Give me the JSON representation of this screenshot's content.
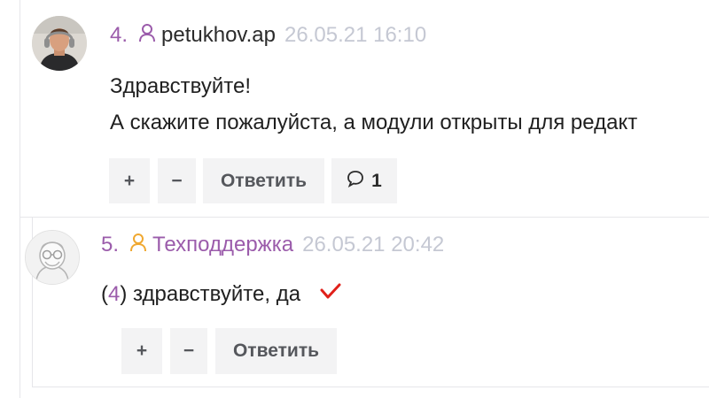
{
  "comments": [
    {
      "number": "4.",
      "username": "petukhov.ap",
      "timestamp": "26.05.21 16:10",
      "lines": [
        "Здравствуйте!",
        "А скажите пожалуйста, а модули открыты для редакт"
      ],
      "actions": {
        "plus": "+",
        "minus": "−",
        "reply": "Ответить",
        "replies_count": "1"
      }
    },
    {
      "number": "5.",
      "username": "Техподдержка",
      "timestamp": "26.05.21 20:42",
      "ref_open": "(",
      "ref_num": "4",
      "ref_close": ")",
      "text": " здравствуйте, да",
      "actions": {
        "plus": "+",
        "minus": "−",
        "reply": "Ответить"
      }
    }
  ],
  "colors": {
    "accent": "#9b5cab",
    "timestamp": "#c5c8d3",
    "button_bg": "#f3f3f4",
    "check": "#e0201a"
  }
}
